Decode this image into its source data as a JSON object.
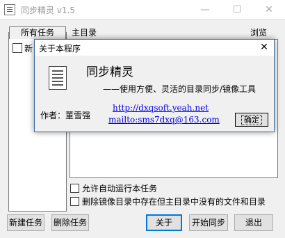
{
  "window": {
    "title": "同步精灵 v1.5",
    "controls": {
      "minimize": "—",
      "maximize": "☐",
      "close": "✕"
    }
  },
  "task_panel": {
    "tab_label": "所有任务",
    "items": [
      {
        "label": "新"
      }
    ]
  },
  "main_dir": {
    "label": "主目录",
    "browse_label": "浏览"
  },
  "options": {
    "autorun_label": "允许自动运行本任务",
    "delete_mirror_label": "删除镜像目录中存在但主目录中没有的文件和目录"
  },
  "buttons": {
    "new_task": "新建任务",
    "delete_task": "删除任务",
    "about": "关于",
    "start_sync": "开始同步",
    "exit": "退出"
  },
  "about_dialog": {
    "title": "关于本程序",
    "close": "✕",
    "app_name": "同步精灵",
    "slogan": "——使用方便、灵活的目录同步/镜像工具",
    "author": "作者：董雪强",
    "website": "http://dxqsoft.yeah.net",
    "email": "mailto:sms7dxq@163.com",
    "ok_label": "确定"
  }
}
